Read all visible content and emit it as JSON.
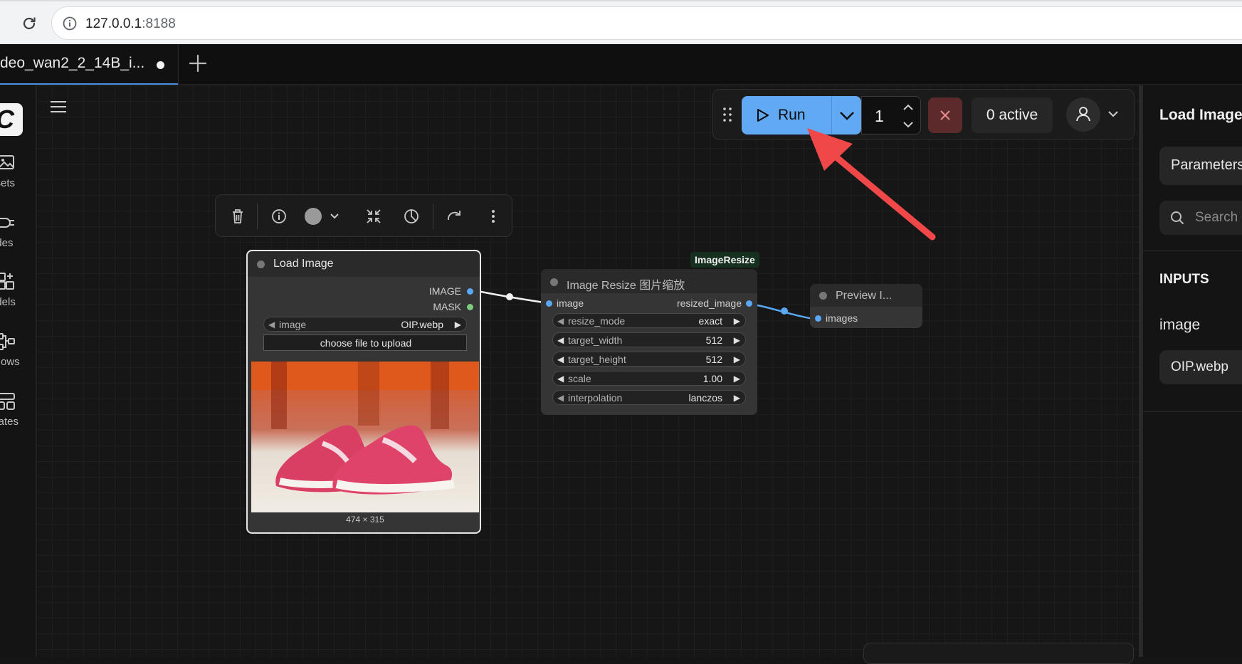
{
  "browser": {
    "url_host": "127.0.0.1",
    "url_port": ":8188"
  },
  "tabs": {
    "active_title": "deo_wan2_2_14B_i..."
  },
  "sidebar": {
    "items": [
      {
        "label": "ssets",
        "icon": "image-icon"
      },
      {
        "label": "odes",
        "icon": "plug-icon"
      },
      {
        "label": "odels",
        "icon": "cube-sparkle-icon"
      },
      {
        "label": "kflows",
        "icon": "workflow-icon"
      },
      {
        "label": "plates",
        "icon": "template-icon"
      }
    ]
  },
  "run_toolbar": {
    "run_label": "Run",
    "queue_count": "1",
    "active_label": "0 active"
  },
  "nodes": {
    "load_image": {
      "title": "Load Image",
      "outputs": [
        "IMAGE",
        "MASK"
      ],
      "widget_name": "image",
      "widget_value": "OIP.webp",
      "upload_label": "choose file to upload",
      "dims": "474 × 315"
    },
    "image_resize": {
      "badge": "ImageResize",
      "title": "Image Resize 图片缩放",
      "input": "image",
      "output": "resized_image",
      "widgets": [
        {
          "name": "resize_mode",
          "value": "exact"
        },
        {
          "name": "target_width",
          "value": "512"
        },
        {
          "name": "target_height",
          "value": "512"
        },
        {
          "name": "scale",
          "value": "1.00"
        },
        {
          "name": "interpolation",
          "value": "lanczos"
        }
      ]
    },
    "preview_image": {
      "title": "Preview I...",
      "input": "images"
    }
  },
  "right_panel": {
    "title": "Load Image",
    "tab_label": "Parameters",
    "search_placeholder": "Search",
    "section": "INPUTS",
    "field_label": "image",
    "field_value": "OIP.webp"
  },
  "colors": {
    "accent_run": "#61a9f2",
    "link_image": "#5aa8f5",
    "link_mask": "#7ccc7c",
    "arrow_annotation": "#f04848"
  }
}
